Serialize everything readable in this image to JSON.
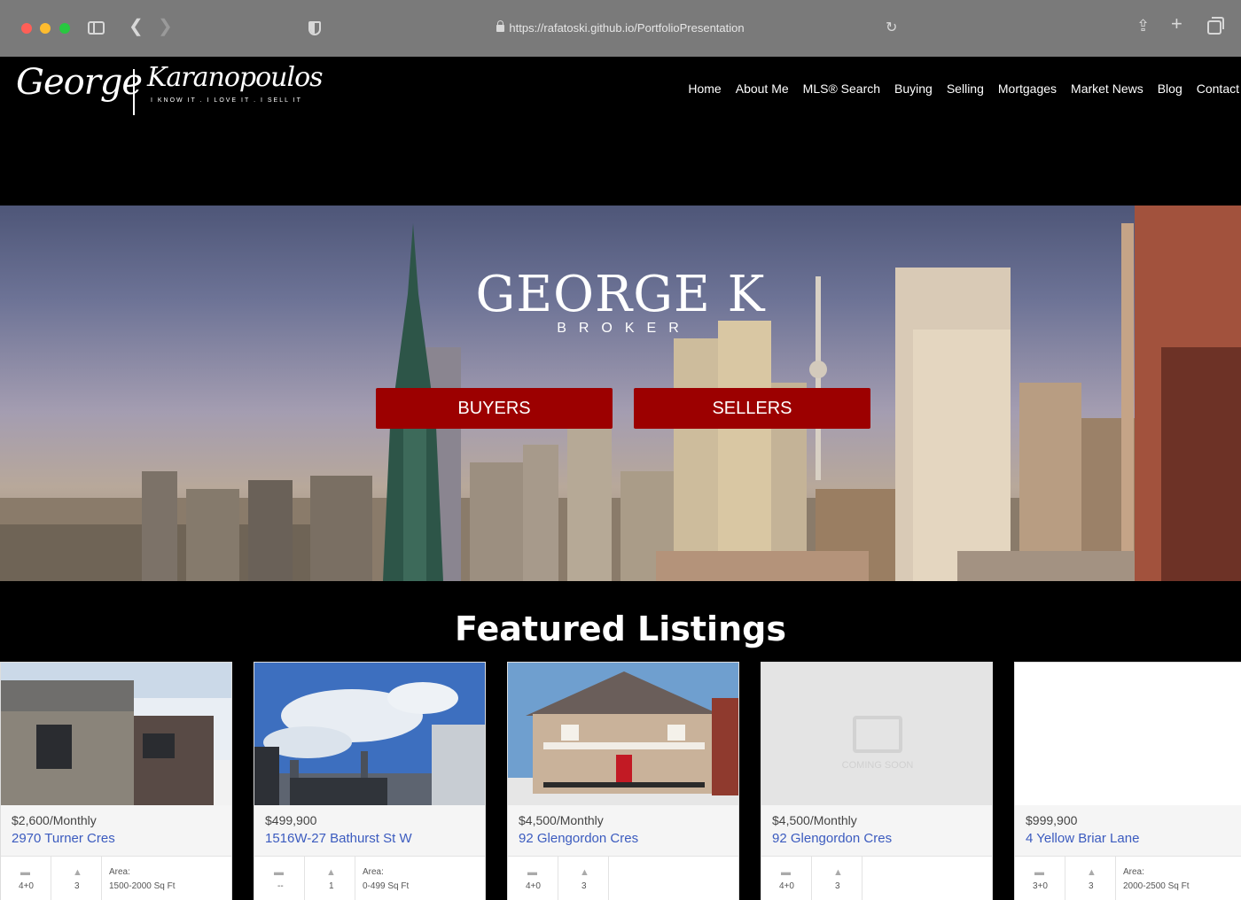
{
  "browser": {
    "url": "https://rafatoski.github.io/PortfolioPresentation"
  },
  "logo": {
    "first": "George",
    "last": "Karanopoulos",
    "tagline": "I KNOW IT . I LOVE IT . I SELL IT"
  },
  "nav": [
    "Home",
    "About Me",
    "MLS® Search",
    "Buying",
    "Selling",
    "Mortgages",
    "Market News",
    "Blog",
    "Contact"
  ],
  "hero": {
    "title": "GEORGE K",
    "subtitle": "BROKER",
    "buyers": "BUYERS",
    "sellers": "SELLERS"
  },
  "featured": {
    "title": "Featured Listings",
    "coming_soon": "COMING SOON",
    "area_label": "Area:",
    "listings": [
      {
        "price": "$2,600/Monthly",
        "address": "2970 Turner Cres",
        "beds": "4+0",
        "baths": "3",
        "area": "1500-2000 Sq Ft"
      },
      {
        "price": "$499,900",
        "address": "1516W-27 Bathurst St W",
        "beds": "--",
        "baths": "1",
        "area": "0-499 Sq Ft"
      },
      {
        "price": "$4,500/Monthly",
        "address": "92 Glengordon Cres",
        "beds": "4+0",
        "baths": "3",
        "area": ""
      },
      {
        "price": "$4,500/Monthly",
        "address": "92 Glengordon Cres",
        "beds": "4+0",
        "baths": "3",
        "area": ""
      },
      {
        "price": "$999,900",
        "address": "4 Yellow Briar Lane",
        "beds": "3+0",
        "baths": "3",
        "area": "2000-2500 Sq Ft"
      }
    ]
  },
  "colors": {
    "accent": "#9c0000",
    "link": "#3b5bbf"
  }
}
